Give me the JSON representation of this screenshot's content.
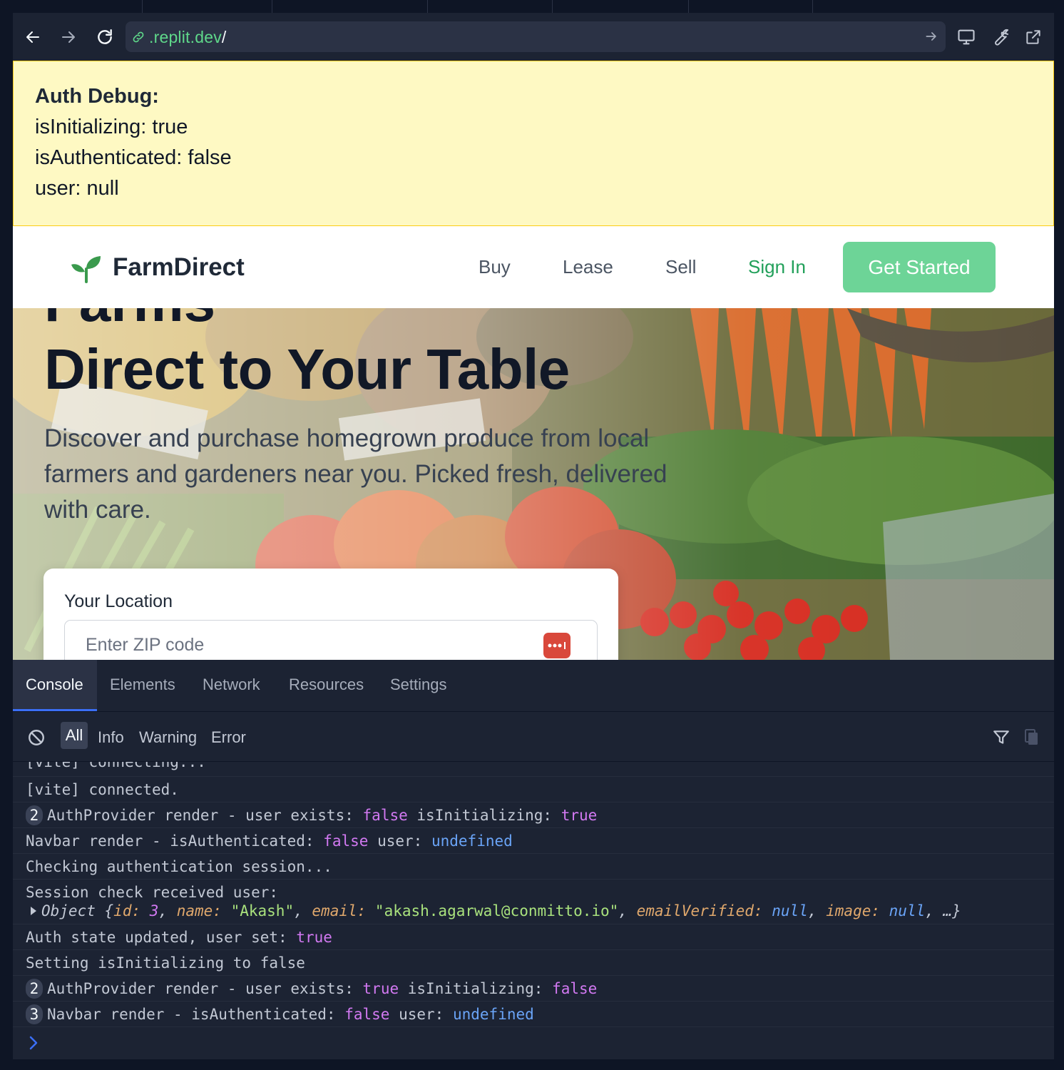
{
  "browser": {
    "url_host": ".replit.dev",
    "url_path": "/"
  },
  "debug": {
    "title": "Auth Debug:",
    "is_initializing": "isInitializing: true",
    "is_authenticated": "isAuthenticated: false",
    "user": "user: null"
  },
  "nav": {
    "brand": "FarmDirect",
    "links": [
      "Buy",
      "Lease",
      "Sell",
      "Sign In"
    ],
    "cta": "Get Started"
  },
  "hero": {
    "heading_cut": "Farms",
    "heading": "Direct to Your Table",
    "subtitle": "Discover and purchase homegrown produce from local farmers and gardeners near you. Picked fresh, delivered with care.",
    "location_label": "Your Location",
    "zip_placeholder": "Enter ZIP code"
  },
  "devtools": {
    "tabs": [
      "Console",
      "Elements",
      "Network",
      "Resources",
      "Settings"
    ],
    "active_tab": "Console",
    "filters": [
      "All",
      "Info",
      "Warning",
      "Error"
    ],
    "active_filter": "All"
  },
  "console": {
    "line0": "[vite] connecting...",
    "line1": "[vite] connected.",
    "line2_badge": "2",
    "line2_text": "AuthProvider render - user exists:",
    "line2_val1": "false",
    "line2_mid": "isInitializing:",
    "line2_val2": "true",
    "line3_text": "Navbar render - isAuthenticated:",
    "line3_val1": "false",
    "line3_mid": "user:",
    "line3_val2": "undefined",
    "line4": "Checking authentication session...",
    "line5": "Session check received user:",
    "line5_obj": "Object",
    "line5_id_key": "id:",
    "line5_id": "3",
    "line5_name_key": "name:",
    "line5_name": "\"Akash\"",
    "line5_email_key": "email:",
    "line5_email": "\"akash.agarwal@conmitto.io\"",
    "line5_ev_key": "emailVerified:",
    "line5_ev": "null",
    "line5_img_key": "image:",
    "line5_img": "null",
    "line5_more": "…}",
    "line6_text": "Auth state updated, user set:",
    "line6_val": "true",
    "line7": "Setting isInitializing to false",
    "line8_badge": "2",
    "line8_text": "AuthProvider render - user exists:",
    "line8_val1": "true",
    "line8_mid": "isInitializing:",
    "line8_val2": "false",
    "line9_badge": "3",
    "line9_text": "Navbar render - isAuthenticated:",
    "line9_val1": "false",
    "line9_mid": "user:",
    "line9_val2": "undefined"
  },
  "colors": {
    "accent_green": "#6dd497",
    "link_green": "#22a05a",
    "debug_bg": "#fef9c3",
    "devtools_bg": "#1c2333",
    "keyword_purple": "#d279f2",
    "null_blue": "#6aa4f7"
  }
}
